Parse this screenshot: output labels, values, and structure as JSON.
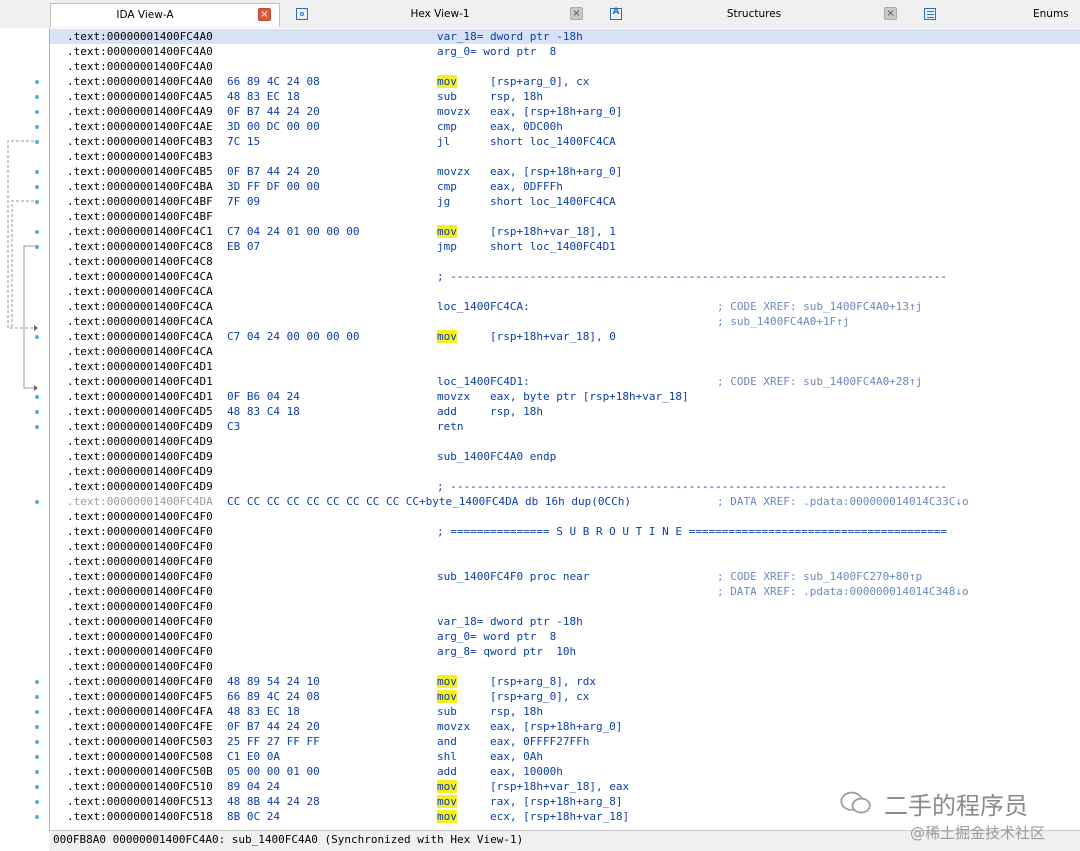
{
  "tabs": [
    {
      "label": "IDA View-A",
      "icon": "document-icon",
      "active": true
    },
    {
      "label": "Hex View-1",
      "icon": "hex-view-icon",
      "active": false
    },
    {
      "label": "Structures",
      "icon": "structures-icon",
      "active": false
    },
    {
      "label": "Enums",
      "icon": "enums-icon",
      "active": false
    }
  ],
  "close_glyph": "×",
  "highlight_mnemonics": [
    "mov"
  ],
  "colors": {
    "address": "#000000",
    "bytes": "#0b3ea8",
    "code": "#0b3ea8",
    "comment": "#6a8abf",
    "highlight": "#f6f11e",
    "current_line": "#d7e3f4",
    "close_active": "#e0563a"
  },
  "lines": [
    {
      "addr": ".text:00000001400FC4A0",
      "bytes": "",
      "code": "var_18= dword ptr -18h",
      "comment": "",
      "hl": true
    },
    {
      "addr": ".text:00000001400FC4A0",
      "bytes": "",
      "code": "arg_0= word ptr  8",
      "comment": ""
    },
    {
      "addr": ".text:00000001400FC4A0",
      "bytes": "",
      "code": "",
      "comment": ""
    },
    {
      "addr": ".text:00000001400FC4A0",
      "bytes": "66 89 4C 24 08",
      "code": "mov     [rsp+arg_0], cx",
      "comment": ""
    },
    {
      "addr": ".text:00000001400FC4A5",
      "bytes": "48 83 EC 18",
      "code": "sub     rsp, 18h",
      "comment": ""
    },
    {
      "addr": ".text:00000001400FC4A9",
      "bytes": "0F B7 44 24 20",
      "code": "movzx   eax, [rsp+18h+arg_0]",
      "comment": ""
    },
    {
      "addr": ".text:00000001400FC4AE",
      "bytes": "3D 00 DC 00 00",
      "code": "cmp     eax, 0DC00h",
      "comment": ""
    },
    {
      "addr": ".text:00000001400FC4B3",
      "bytes": "7C 15",
      "code": "jl      short loc_1400FC4CA",
      "comment": ""
    },
    {
      "addr": ".text:00000001400FC4B3",
      "bytes": "",
      "code": "",
      "comment": ""
    },
    {
      "addr": ".text:00000001400FC4B5",
      "bytes": "0F B7 44 24 20",
      "code": "movzx   eax, [rsp+18h+arg_0]",
      "comment": ""
    },
    {
      "addr": ".text:00000001400FC4BA",
      "bytes": "3D FF DF 00 00",
      "code": "cmp     eax, 0DFFFh",
      "comment": ""
    },
    {
      "addr": ".text:00000001400FC4BF",
      "bytes": "7F 09",
      "code": "jg      short loc_1400FC4CA",
      "comment": ""
    },
    {
      "addr": ".text:00000001400FC4BF",
      "bytes": "",
      "code": "",
      "comment": ""
    },
    {
      "addr": ".text:00000001400FC4C1",
      "bytes": "C7 04 24 01 00 00 00",
      "code": "mov     [rsp+18h+var_18], 1",
      "comment": ""
    },
    {
      "addr": ".text:00000001400FC4C8",
      "bytes": "EB 07",
      "code": "jmp     short loc_1400FC4D1",
      "comment": ""
    },
    {
      "addr": ".text:00000001400FC4C8",
      "bytes": "",
      "code": "",
      "comment": ""
    },
    {
      "addr": ".text:00000001400FC4CA",
      "bytes": "",
      "code": "; ---------------------------------------------------------------------------",
      "comment": ""
    },
    {
      "addr": ".text:00000001400FC4CA",
      "bytes": "",
      "code": "",
      "comment": ""
    },
    {
      "addr": ".text:00000001400FC4CA",
      "bytes": "",
      "code": "loc_1400FC4CA:",
      "comment": "; CODE XREF: sub_1400FC4A0+13↑j"
    },
    {
      "addr": ".text:00000001400FC4CA",
      "bytes": "",
      "code": "",
      "comment": "; sub_1400FC4A0+1F↑j"
    },
    {
      "addr": ".text:00000001400FC4CA",
      "bytes": "C7 04 24 00 00 00 00",
      "code": "mov     [rsp+18h+var_18], 0",
      "comment": ""
    },
    {
      "addr": ".text:00000001400FC4CA",
      "bytes": "",
      "code": "",
      "comment": ""
    },
    {
      "addr": ".text:00000001400FC4D1",
      "bytes": "",
      "code": "",
      "comment": ""
    },
    {
      "addr": ".text:00000001400FC4D1",
      "bytes": "",
      "code": "loc_1400FC4D1:",
      "comment": "; CODE XREF: sub_1400FC4A0+28↑j"
    },
    {
      "addr": ".text:00000001400FC4D1",
      "bytes": "0F B6 04 24",
      "code": "movzx   eax, byte ptr [rsp+18h+var_18]",
      "comment": ""
    },
    {
      "addr": ".text:00000001400FC4D5",
      "bytes": "48 83 C4 18",
      "code": "add     rsp, 18h",
      "comment": ""
    },
    {
      "addr": ".text:00000001400FC4D9",
      "bytes": "C3",
      "code": "retn",
      "comment": ""
    },
    {
      "addr": ".text:00000001400FC4D9",
      "bytes": "",
      "code": "",
      "comment": ""
    },
    {
      "addr": ".text:00000001400FC4D9",
      "bytes": "",
      "code": "sub_1400FC4A0 endp",
      "comment": ""
    },
    {
      "addr": ".text:00000001400FC4D9",
      "bytes": "",
      "code": "",
      "comment": ""
    },
    {
      "addr": ".text:00000001400FC4D9",
      "bytes": "",
      "code": "; ---------------------------------------------------------------------------",
      "comment": ""
    },
    {
      "addr": ".text:00000001400FC4DA",
      "bytes": "CC CC CC CC CC CC CC CC CC CC+byte_1400FC4DA db 16h dup(0CCh)",
      "code": "",
      "comment": "; DATA XREF: .pdata:000000014014C33C↓o",
      "gray": true
    },
    {
      "addr": ".text:00000001400FC4F0",
      "bytes": "",
      "code": "",
      "comment": ""
    },
    {
      "addr": ".text:00000001400FC4F0",
      "bytes": "",
      "code": "; =============== S U B R O U T I N E =======================================",
      "comment": ""
    },
    {
      "addr": ".text:00000001400FC4F0",
      "bytes": "",
      "code": "",
      "comment": ""
    },
    {
      "addr": ".text:00000001400FC4F0",
      "bytes": "",
      "code": "",
      "comment": ""
    },
    {
      "addr": ".text:00000001400FC4F0",
      "bytes": "",
      "code": "sub_1400FC4F0 proc near",
      "comment": "; CODE XREF: sub_1400FC270+80↑p"
    },
    {
      "addr": ".text:00000001400FC4F0",
      "bytes": "",
      "code": "",
      "comment": "; DATA XREF: .pdata:000000014014C348↓o"
    },
    {
      "addr": ".text:00000001400FC4F0",
      "bytes": "",
      "code": "",
      "comment": ""
    },
    {
      "addr": ".text:00000001400FC4F0",
      "bytes": "",
      "code": "var_18= dword ptr -18h",
      "comment": ""
    },
    {
      "addr": ".text:00000001400FC4F0",
      "bytes": "",
      "code": "arg_0= word ptr  8",
      "comment": ""
    },
    {
      "addr": ".text:00000001400FC4F0",
      "bytes": "",
      "code": "arg_8= qword ptr  10h",
      "comment": ""
    },
    {
      "addr": ".text:00000001400FC4F0",
      "bytes": "",
      "code": "",
      "comment": ""
    },
    {
      "addr": ".text:00000001400FC4F0",
      "bytes": "48 89 54 24 10",
      "code": "mov     [rsp+arg_8], rdx",
      "comment": ""
    },
    {
      "addr": ".text:00000001400FC4F5",
      "bytes": "66 89 4C 24 08",
      "code": "mov     [rsp+arg_0], cx",
      "comment": ""
    },
    {
      "addr": ".text:00000001400FC4FA",
      "bytes": "48 83 EC 18",
      "code": "sub     rsp, 18h",
      "comment": ""
    },
    {
      "addr": ".text:00000001400FC4FE",
      "bytes": "0F B7 44 24 20",
      "code": "movzx   eax, [rsp+18h+arg_0]",
      "comment": ""
    },
    {
      "addr": ".text:00000001400FC503",
      "bytes": "25 FF 27 FF FF",
      "code": "and     eax, 0FFFF27FFh",
      "comment": ""
    },
    {
      "addr": ".text:00000001400FC508",
      "bytes": "C1 E0 0A",
      "code": "shl     eax, 0Ah",
      "comment": ""
    },
    {
      "addr": ".text:00000001400FC50B",
      "bytes": "05 00 00 01 00",
      "code": "add     eax, 10000h",
      "comment": ""
    },
    {
      "addr": ".text:00000001400FC510",
      "bytes": "89 04 24",
      "code": "mov     [rsp+18h+var_18], eax",
      "comment": ""
    },
    {
      "addr": ".text:00000001400FC513",
      "bytes": "48 8B 44 24 28",
      "code": "mov     rax, [rsp+18h+arg_8]",
      "comment": ""
    },
    {
      "addr": ".text:00000001400FC518",
      "bytes": "8B 0C 24",
      "code": "mov     ecx, [rsp+18h+var_18]",
      "comment": ""
    }
  ],
  "status_text": "000FB8A0 00000001400FC4A0: sub_1400FC4A0 (Synchronized with Hex View-1)",
  "watermark": {
    "name": "二手的程序员",
    "site": "@稀土掘金技术社区"
  }
}
